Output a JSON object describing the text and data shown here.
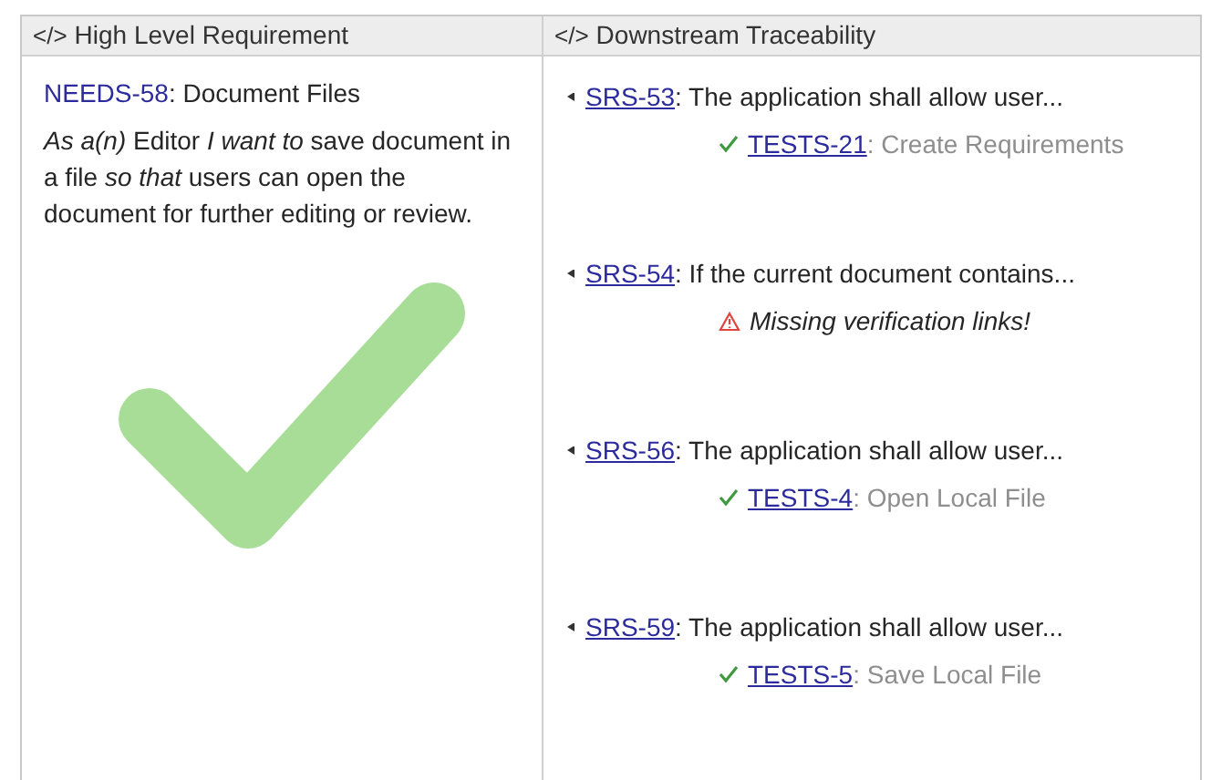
{
  "columns": [
    {
      "icon": "</>",
      "label": "High Level Requirement"
    },
    {
      "icon": "</>",
      "label": "Downstream Traceability"
    }
  ],
  "requirement": {
    "id": "NEEDS-58",
    "title": ": Document Files",
    "description": "*As a(n)* Editor *I want to* save document in a file *so that* users can open the document for further editing or review.",
    "verified": true
  },
  "downstream": [
    {
      "id": "SRS-53",
      "text": ": The application shall allow user...",
      "verification": {
        "kind": "test",
        "id": "TESTS-21",
        "title": ": Create Requirements"
      }
    },
    {
      "id": "SRS-54",
      "text": ": If the current document contains...",
      "verification": {
        "kind": "missing",
        "message": "Missing verification links!"
      }
    },
    {
      "id": "SRS-56",
      "text": ": The application shall allow user...",
      "verification": {
        "kind": "test",
        "id": "TESTS-4",
        "title": ": Open Local File"
      }
    },
    {
      "id": "SRS-59",
      "text": ": The application shall allow user...",
      "verification": {
        "kind": "test",
        "id": "TESTS-5",
        "title": ": Save Local File"
      }
    }
  ]
}
